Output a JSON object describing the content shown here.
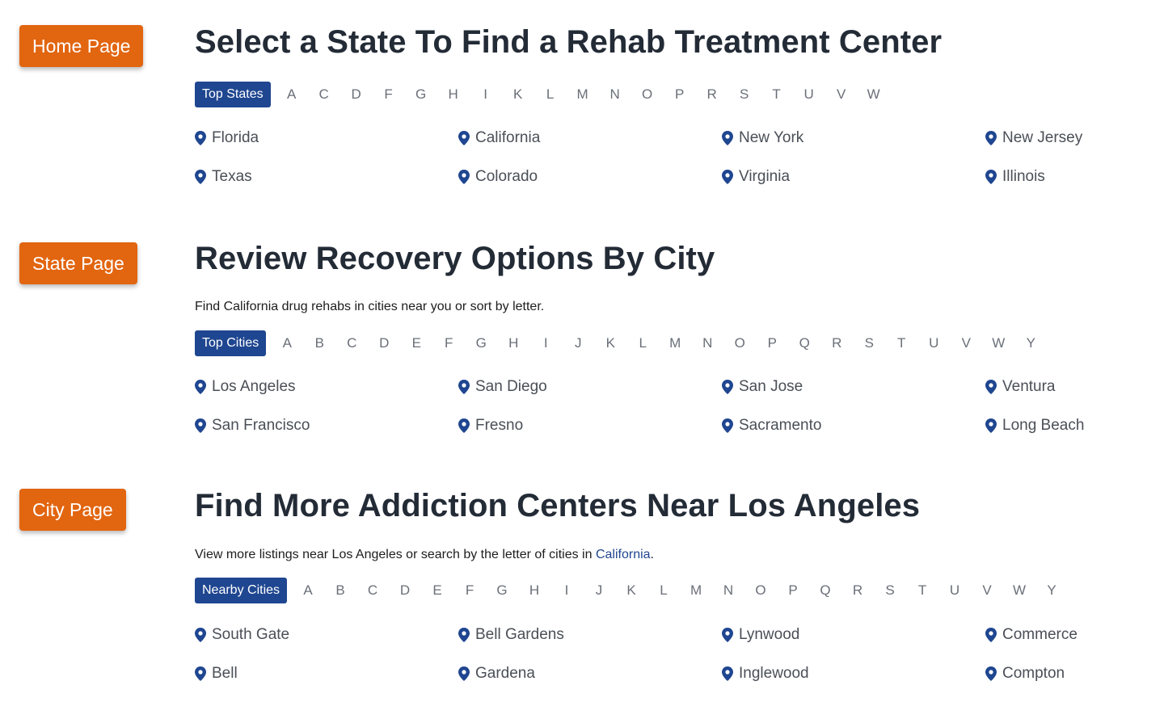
{
  "sections": {
    "home": {
      "badge": "Home Page",
      "title": "Select a State To Find a Rehab Treatment Center",
      "active_tab": "Top States",
      "letters": [
        "A",
        "C",
        "D",
        "F",
        "G",
        "H",
        "I",
        "K",
        "L",
        "M",
        "N",
        "O",
        "P",
        "R",
        "S",
        "T",
        "U",
        "V",
        "W"
      ],
      "items": [
        "Florida",
        "California",
        "New York",
        "New Jersey",
        "Texas",
        "Colorado",
        "Virginia",
        "Illinois"
      ]
    },
    "state": {
      "badge": "State Page",
      "title": "Review Recovery Options By City",
      "subtitle": "Find California drug rehabs in cities near you or sort by letter.",
      "active_tab": "Top Cities",
      "letters": [
        "A",
        "B",
        "C",
        "D",
        "E",
        "F",
        "G",
        "H",
        "I",
        "J",
        "K",
        "L",
        "M",
        "N",
        "O",
        "P",
        "Q",
        "R",
        "S",
        "T",
        "U",
        "V",
        "W",
        "Y"
      ],
      "items": [
        "Los Angeles",
        "San Diego",
        "San Jose",
        "Ventura",
        "San Francisco",
        "Fresno",
        "Sacramento",
        "Long Beach"
      ]
    },
    "city": {
      "badge": "City Page",
      "title": "Find More Addiction Centers Near Los Angeles",
      "subtitle_prefix": "View more listings near Los Angeles or search by the letter of cities in ",
      "subtitle_link": "California",
      "subtitle_suffix": ".",
      "active_tab": "Nearby Cities",
      "letters": [
        "A",
        "B",
        "C",
        "D",
        "E",
        "F",
        "G",
        "H",
        "I",
        "J",
        "K",
        "L",
        "M",
        "N",
        "O",
        "P",
        "Q",
        "R",
        "S",
        "T",
        "U",
        "V",
        "W",
        "Y"
      ],
      "items": [
        "South Gate",
        "Bell Gardens",
        "Lynwood",
        "Commerce",
        "Bell",
        "Gardena",
        "Inglewood",
        "Compton"
      ]
    }
  },
  "icons": {
    "location": "map-pin-icon"
  },
  "colors": {
    "badge": "#e2650f",
    "accent": "#1f4690",
    "heading": "#232b36",
    "link": "#1f4690"
  }
}
